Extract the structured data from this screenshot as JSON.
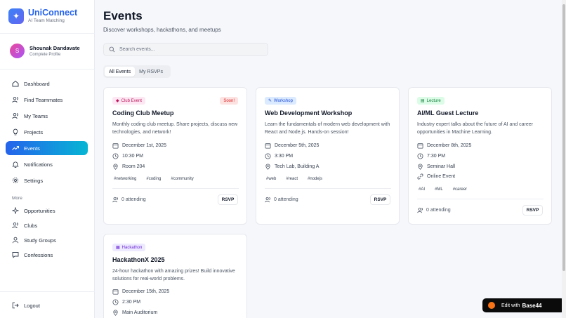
{
  "brand": {
    "name": "UniConnect",
    "tagline": "AI Team Matching"
  },
  "profile": {
    "initial": "S",
    "name": "Shounak Dandavate",
    "subtitle": "Complete Profile"
  },
  "nav": {
    "items": [
      {
        "label": "Dashboard",
        "icon": "home-icon"
      },
      {
        "label": "Find Teammates",
        "icon": "users-icon"
      },
      {
        "label": "My Teams",
        "icon": "users-icon"
      },
      {
        "label": "Projects",
        "icon": "lightbulb-icon"
      },
      {
        "label": "Events",
        "icon": "trending-icon"
      },
      {
        "label": "Notifications",
        "icon": "bell-icon"
      },
      {
        "label": "Settings",
        "icon": "gear-icon"
      }
    ],
    "more_label": "More",
    "more_items": [
      {
        "label": "Opportunities",
        "icon": "sparkle-icon"
      },
      {
        "label": "Clubs",
        "icon": "users-icon"
      },
      {
        "label": "Study Groups",
        "icon": "user-icon"
      },
      {
        "label": "Confessions",
        "icon": "message-icon"
      }
    ],
    "logout": "Logout"
  },
  "page": {
    "title": "Events",
    "subtitle": "Discover workshops, hackathons, and meetups"
  },
  "search": {
    "placeholder": "Search events..."
  },
  "tabs": [
    "All Events",
    "My RSVPs"
  ],
  "events": [
    {
      "category": "Club Event",
      "category_color": "#fce7f3",
      "category_text": "#be185d",
      "badge": "Soon!",
      "title": "Coding Club Meetup",
      "description": "Monthly coding club meetup. Share projects, discuss new technologies, and network!",
      "date": "December 1st, 2025",
      "time": "10:30 PM",
      "location": "Room 204",
      "tags": [
        "#networking",
        "#coding",
        "#community"
      ],
      "attending": "0 attending",
      "rsvp": "RSVP"
    },
    {
      "category": "Workshop",
      "category_color": "#dbeafe",
      "category_text": "#1d4ed8",
      "title": "Web Development Workshop",
      "description": "Learn the fundamentals of modern web development with React and Node.js. Hands-on session!",
      "date": "December 5th, 2025",
      "time": "3:30 PM",
      "location": "Tech Lab, Building A",
      "tags": [
        "#web",
        "#react",
        "#nodejs"
      ],
      "attending": "0 attending",
      "rsvp": "RSVP"
    },
    {
      "category": "Lecture",
      "category_color": "#dcfce7",
      "category_text": "#15803d",
      "title": "AI/ML Guest Lecture",
      "description": "Industry expert talks about the future of AI and career opportunities in Machine Learning.",
      "date": "December 8th, 2025",
      "time": "7:30 PM",
      "location": "Seminar Hall",
      "online": "Online Event",
      "tags": [
        "#AI",
        "#ML",
        "#career"
      ],
      "attending": "0 attending",
      "rsvp": "RSVP"
    },
    {
      "category": "Hackathon",
      "category_color": "#ede9fe",
      "category_text": "#6d28d9",
      "title": "HackathonX 2025",
      "description": "24-hour hackathon with amazing prizes! Build innovative solutions for real-world problems.",
      "date": "December 15th, 2025",
      "time": "2:30 PM",
      "location": "Main Auditorium"
    }
  ],
  "badge": {
    "prefix": "Edit with",
    "brand": "Base44"
  }
}
